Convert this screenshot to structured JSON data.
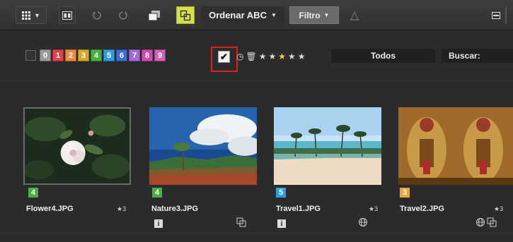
{
  "toolbar": {
    "sort_label": "Ordenar ABC",
    "filter_label": "Filtro",
    "icons": [
      "grid-view-icon",
      "compare-icon",
      "rotate-left-icon",
      "rotate-right-icon",
      "stack-icon",
      "sync-icon",
      "marker-icon",
      "menu-icon"
    ]
  },
  "filterbar": {
    "labels": [
      {
        "num": "0",
        "color": "#9a9a9a"
      },
      {
        "num": "1",
        "color": "#e0404a"
      },
      {
        "num": "2",
        "color": "#f08840"
      },
      {
        "num": "3",
        "color": "#d8a828"
      },
      {
        "num": "4",
        "color": "#46b040"
      },
      {
        "num": "5",
        "color": "#2e9ee0"
      },
      {
        "num": "6",
        "color": "#3c6ed8"
      },
      {
        "num": "7",
        "color": "#a06ad8"
      },
      {
        "num": "8",
        "color": "#d04aa8"
      },
      {
        "num": "9",
        "color": "#d060b8"
      }
    ],
    "rating_check": "✔",
    "todos_label": "Todos",
    "search_label": "Buscar:"
  },
  "images": [
    {
      "filename": "Flower4.JPG",
      "label": "4",
      "label_color": "#46b040",
      "rating": "★3"
    },
    {
      "filename": "Nature3.JPG",
      "label": "4",
      "label_color": "#46b040",
      "rating": ""
    },
    {
      "filename": "Travel1.JPG",
      "label": "5",
      "label_color": "#2e9ee0",
      "rating": "★3"
    },
    {
      "filename": "Travel2.JPG",
      "label": "3",
      "label_color": "#e8a838",
      "rating": "★3"
    }
  ],
  "colors": {
    "sync_active": "#d7e04c",
    "highlight": "#e02020",
    "star_active": "#f3d23a"
  }
}
